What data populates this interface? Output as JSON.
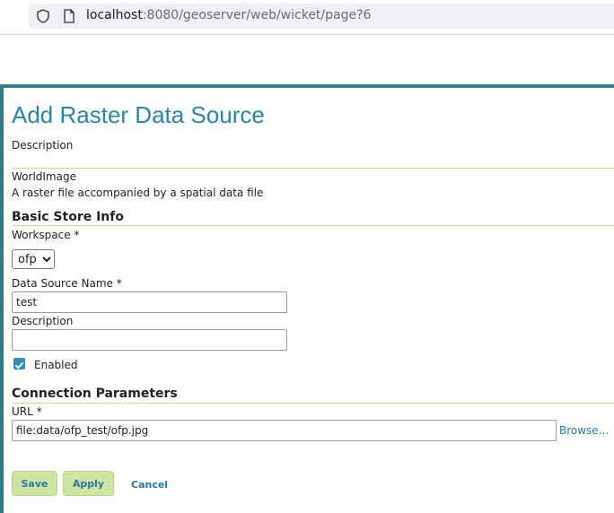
{
  "browser": {
    "url_host": "localhost",
    "url_rest": ":8080/geoserver/web/wicket/page?6"
  },
  "page": {
    "title": "Add Raster Data Source",
    "description_label": "Description",
    "store_type": "WorldImage",
    "store_type_description": "A raster file accompanied by a spatial data file"
  },
  "basic_info": {
    "section_title": "Basic Store Info",
    "workspace_label": "Workspace *",
    "workspace_selected": "ofp",
    "name_label": "Data Source Name *",
    "name_value": "test",
    "description_label": "Description",
    "description_value": "",
    "enabled_label": "Enabled",
    "enabled_checked": true
  },
  "connection": {
    "section_title": "Connection Parameters",
    "url_label": "URL *",
    "url_value": "file:data/ofp_test/ofp.jpg",
    "browse_label": "Browse..."
  },
  "actions": {
    "save_label": "Save",
    "apply_label": "Apply",
    "cancel_label": "Cancel"
  },
  "colors": {
    "accent": "#2a85a6",
    "frame": "#2f7f8a",
    "button_bg": "#cfe6a3",
    "rule": "#c9d9a3"
  }
}
